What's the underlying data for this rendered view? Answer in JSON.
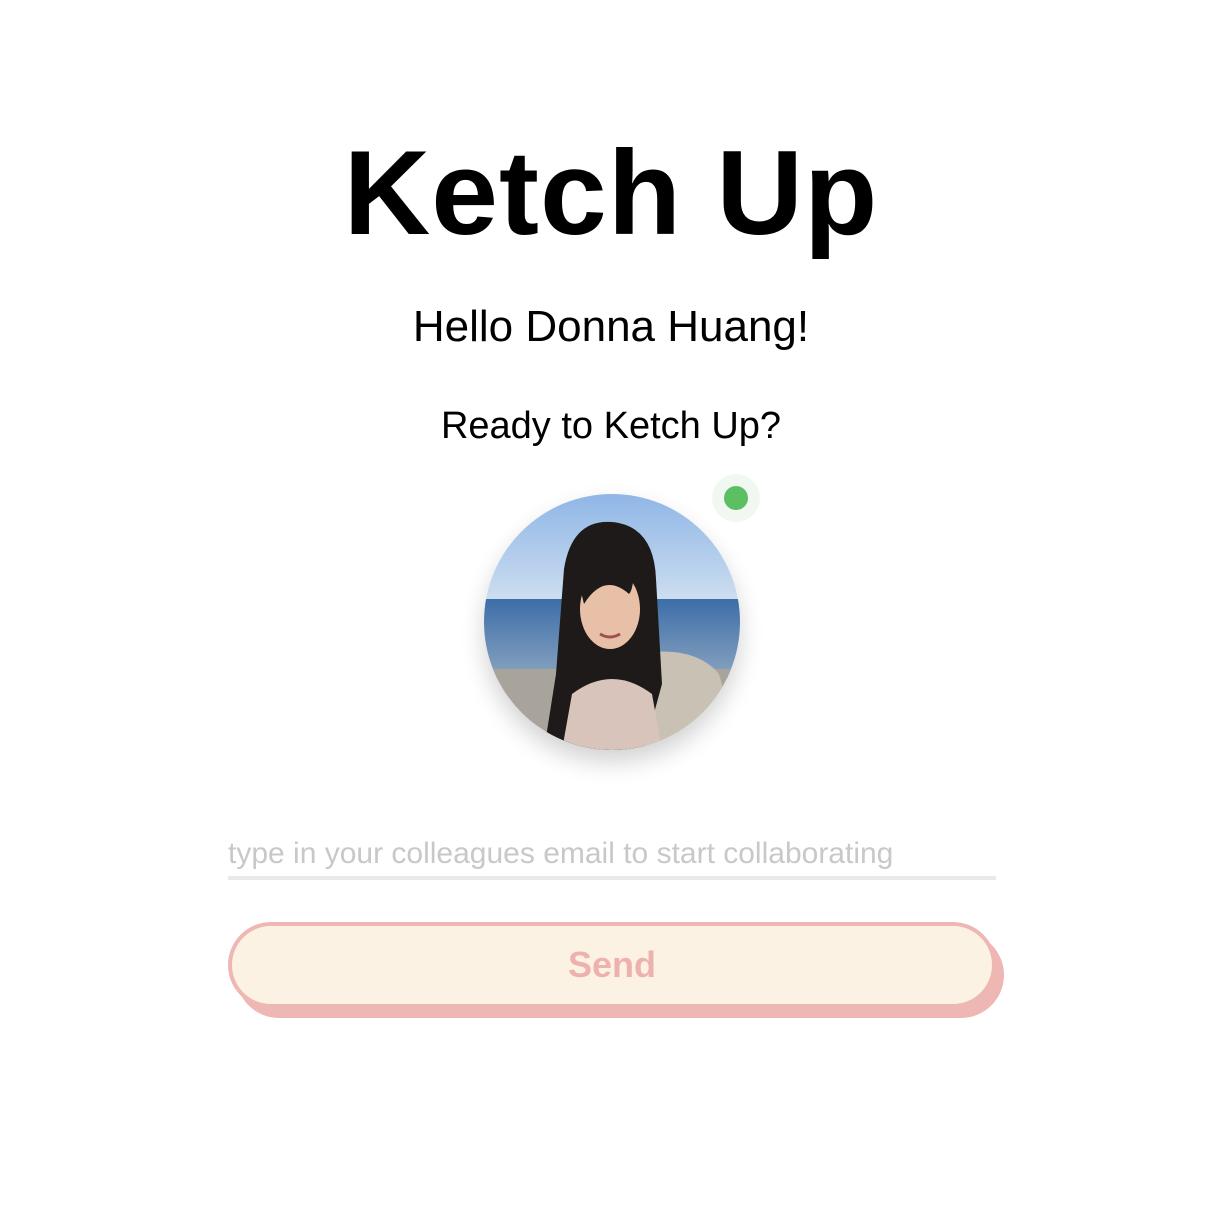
{
  "app": {
    "title": "Ketch Up"
  },
  "greeting": {
    "text": "Hello Donna Huang!"
  },
  "prompt": {
    "text": "Ready to Ketch Up?"
  },
  "profile": {
    "avatar_icon": "user-photo",
    "status": "online",
    "status_color": "#5cc063"
  },
  "invite": {
    "email_placeholder": "type in your colleagues email to start collaborating",
    "email_value": "",
    "send_label": "Send"
  },
  "colors": {
    "button_fill": "#fcf2e3",
    "button_accent": "#eeb7b3"
  }
}
